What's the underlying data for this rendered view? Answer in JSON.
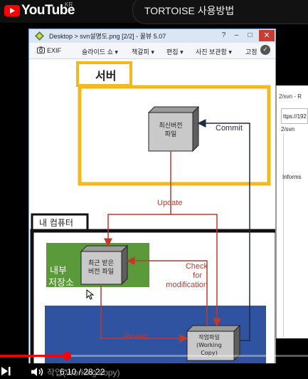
{
  "youtube": {
    "logo_text": "YouTube",
    "region": "KR",
    "video_title": "TORTOISE 사용방법"
  },
  "background_window": {
    "title": "2/svn - R",
    "url": "ttps://192",
    "path": "2/svn",
    "text": "Informs"
  },
  "viewer": {
    "title": "Desktop > svn설명도.png [2/2] - 꿀뷰 5.07",
    "window_buttons": {
      "help": "?",
      "minimize": "–",
      "maximize": "□",
      "close": "✕"
    },
    "toolbar": {
      "exif": "EXIF",
      "slideshow": "슬라이드 쇼",
      "bookmark": "책갈피",
      "edit": "편집",
      "photo_storage": "사진 보관함",
      "pin": "고정"
    }
  },
  "diagram": {
    "server_label": "서버",
    "my_computer_label": "내 컴퓨터",
    "internal_storage_label_line1": "내부",
    "internal_storage_label_line2": "저장소",
    "server_file": [
      "최신버전",
      "파일"
    ],
    "local_file": [
      "최근 받은",
      "버전 파일"
    ],
    "working_copy": [
      "작업파일",
      "(Working",
      "Copy)"
    ],
    "arrows": {
      "commit": "Commit",
      "update": "Update",
      "check_modification": [
        "Check",
        "for",
        "modification"
      ],
      "revert": "Revert"
    },
    "colors": {
      "server_border": "#f2b81c",
      "computer_border": "#111111",
      "storage_fill": "#5b9a3a",
      "workspace_fill": "#2f52a1",
      "arrow_red": "#c0392b",
      "arrow_dark": "#1f2a44"
    }
  },
  "player": {
    "current_time": "6:10",
    "duration": "28:22",
    "caption_ghost": "작업(Working copy)",
    "progress_fraction": 0.217
  }
}
